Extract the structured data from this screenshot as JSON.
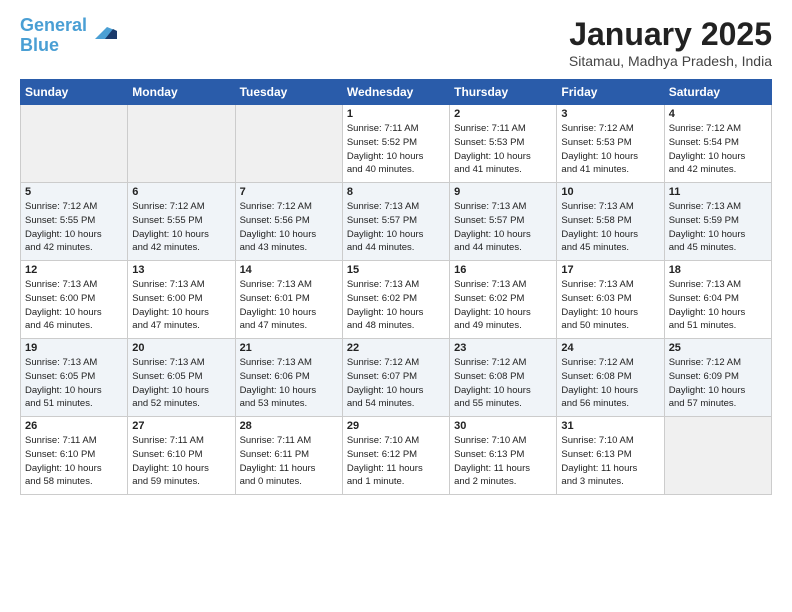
{
  "header": {
    "logo_line1": "General",
    "logo_line2": "Blue",
    "month_title": "January 2025",
    "location": "Sitamau, Madhya Pradesh, India"
  },
  "days_of_week": [
    "Sunday",
    "Monday",
    "Tuesday",
    "Wednesday",
    "Thursday",
    "Friday",
    "Saturday"
  ],
  "weeks": [
    [
      {
        "day": "",
        "info": ""
      },
      {
        "day": "",
        "info": ""
      },
      {
        "day": "",
        "info": ""
      },
      {
        "day": "1",
        "info": "Sunrise: 7:11 AM\nSunset: 5:52 PM\nDaylight: 10 hours\nand 40 minutes."
      },
      {
        "day": "2",
        "info": "Sunrise: 7:11 AM\nSunset: 5:53 PM\nDaylight: 10 hours\nand 41 minutes."
      },
      {
        "day": "3",
        "info": "Sunrise: 7:12 AM\nSunset: 5:53 PM\nDaylight: 10 hours\nand 41 minutes."
      },
      {
        "day": "4",
        "info": "Sunrise: 7:12 AM\nSunset: 5:54 PM\nDaylight: 10 hours\nand 42 minutes."
      }
    ],
    [
      {
        "day": "5",
        "info": "Sunrise: 7:12 AM\nSunset: 5:55 PM\nDaylight: 10 hours\nand 42 minutes."
      },
      {
        "day": "6",
        "info": "Sunrise: 7:12 AM\nSunset: 5:55 PM\nDaylight: 10 hours\nand 42 minutes."
      },
      {
        "day": "7",
        "info": "Sunrise: 7:12 AM\nSunset: 5:56 PM\nDaylight: 10 hours\nand 43 minutes."
      },
      {
        "day": "8",
        "info": "Sunrise: 7:13 AM\nSunset: 5:57 PM\nDaylight: 10 hours\nand 44 minutes."
      },
      {
        "day": "9",
        "info": "Sunrise: 7:13 AM\nSunset: 5:57 PM\nDaylight: 10 hours\nand 44 minutes."
      },
      {
        "day": "10",
        "info": "Sunrise: 7:13 AM\nSunset: 5:58 PM\nDaylight: 10 hours\nand 45 minutes."
      },
      {
        "day": "11",
        "info": "Sunrise: 7:13 AM\nSunset: 5:59 PM\nDaylight: 10 hours\nand 45 minutes."
      }
    ],
    [
      {
        "day": "12",
        "info": "Sunrise: 7:13 AM\nSunset: 6:00 PM\nDaylight: 10 hours\nand 46 minutes."
      },
      {
        "day": "13",
        "info": "Sunrise: 7:13 AM\nSunset: 6:00 PM\nDaylight: 10 hours\nand 47 minutes."
      },
      {
        "day": "14",
        "info": "Sunrise: 7:13 AM\nSunset: 6:01 PM\nDaylight: 10 hours\nand 47 minutes."
      },
      {
        "day": "15",
        "info": "Sunrise: 7:13 AM\nSunset: 6:02 PM\nDaylight: 10 hours\nand 48 minutes."
      },
      {
        "day": "16",
        "info": "Sunrise: 7:13 AM\nSunset: 6:02 PM\nDaylight: 10 hours\nand 49 minutes."
      },
      {
        "day": "17",
        "info": "Sunrise: 7:13 AM\nSunset: 6:03 PM\nDaylight: 10 hours\nand 50 minutes."
      },
      {
        "day": "18",
        "info": "Sunrise: 7:13 AM\nSunset: 6:04 PM\nDaylight: 10 hours\nand 51 minutes."
      }
    ],
    [
      {
        "day": "19",
        "info": "Sunrise: 7:13 AM\nSunset: 6:05 PM\nDaylight: 10 hours\nand 51 minutes."
      },
      {
        "day": "20",
        "info": "Sunrise: 7:13 AM\nSunset: 6:05 PM\nDaylight: 10 hours\nand 52 minutes."
      },
      {
        "day": "21",
        "info": "Sunrise: 7:13 AM\nSunset: 6:06 PM\nDaylight: 10 hours\nand 53 minutes."
      },
      {
        "day": "22",
        "info": "Sunrise: 7:12 AM\nSunset: 6:07 PM\nDaylight: 10 hours\nand 54 minutes."
      },
      {
        "day": "23",
        "info": "Sunrise: 7:12 AM\nSunset: 6:08 PM\nDaylight: 10 hours\nand 55 minutes."
      },
      {
        "day": "24",
        "info": "Sunrise: 7:12 AM\nSunset: 6:08 PM\nDaylight: 10 hours\nand 56 minutes."
      },
      {
        "day": "25",
        "info": "Sunrise: 7:12 AM\nSunset: 6:09 PM\nDaylight: 10 hours\nand 57 minutes."
      }
    ],
    [
      {
        "day": "26",
        "info": "Sunrise: 7:11 AM\nSunset: 6:10 PM\nDaylight: 10 hours\nand 58 minutes."
      },
      {
        "day": "27",
        "info": "Sunrise: 7:11 AM\nSunset: 6:10 PM\nDaylight: 10 hours\nand 59 minutes."
      },
      {
        "day": "28",
        "info": "Sunrise: 7:11 AM\nSunset: 6:11 PM\nDaylight: 11 hours\nand 0 minutes."
      },
      {
        "day": "29",
        "info": "Sunrise: 7:10 AM\nSunset: 6:12 PM\nDaylight: 11 hours\nand 1 minute."
      },
      {
        "day": "30",
        "info": "Sunrise: 7:10 AM\nSunset: 6:13 PM\nDaylight: 11 hours\nand 2 minutes."
      },
      {
        "day": "31",
        "info": "Sunrise: 7:10 AM\nSunset: 6:13 PM\nDaylight: 11 hours\nand 3 minutes."
      },
      {
        "day": "",
        "info": ""
      }
    ]
  ]
}
